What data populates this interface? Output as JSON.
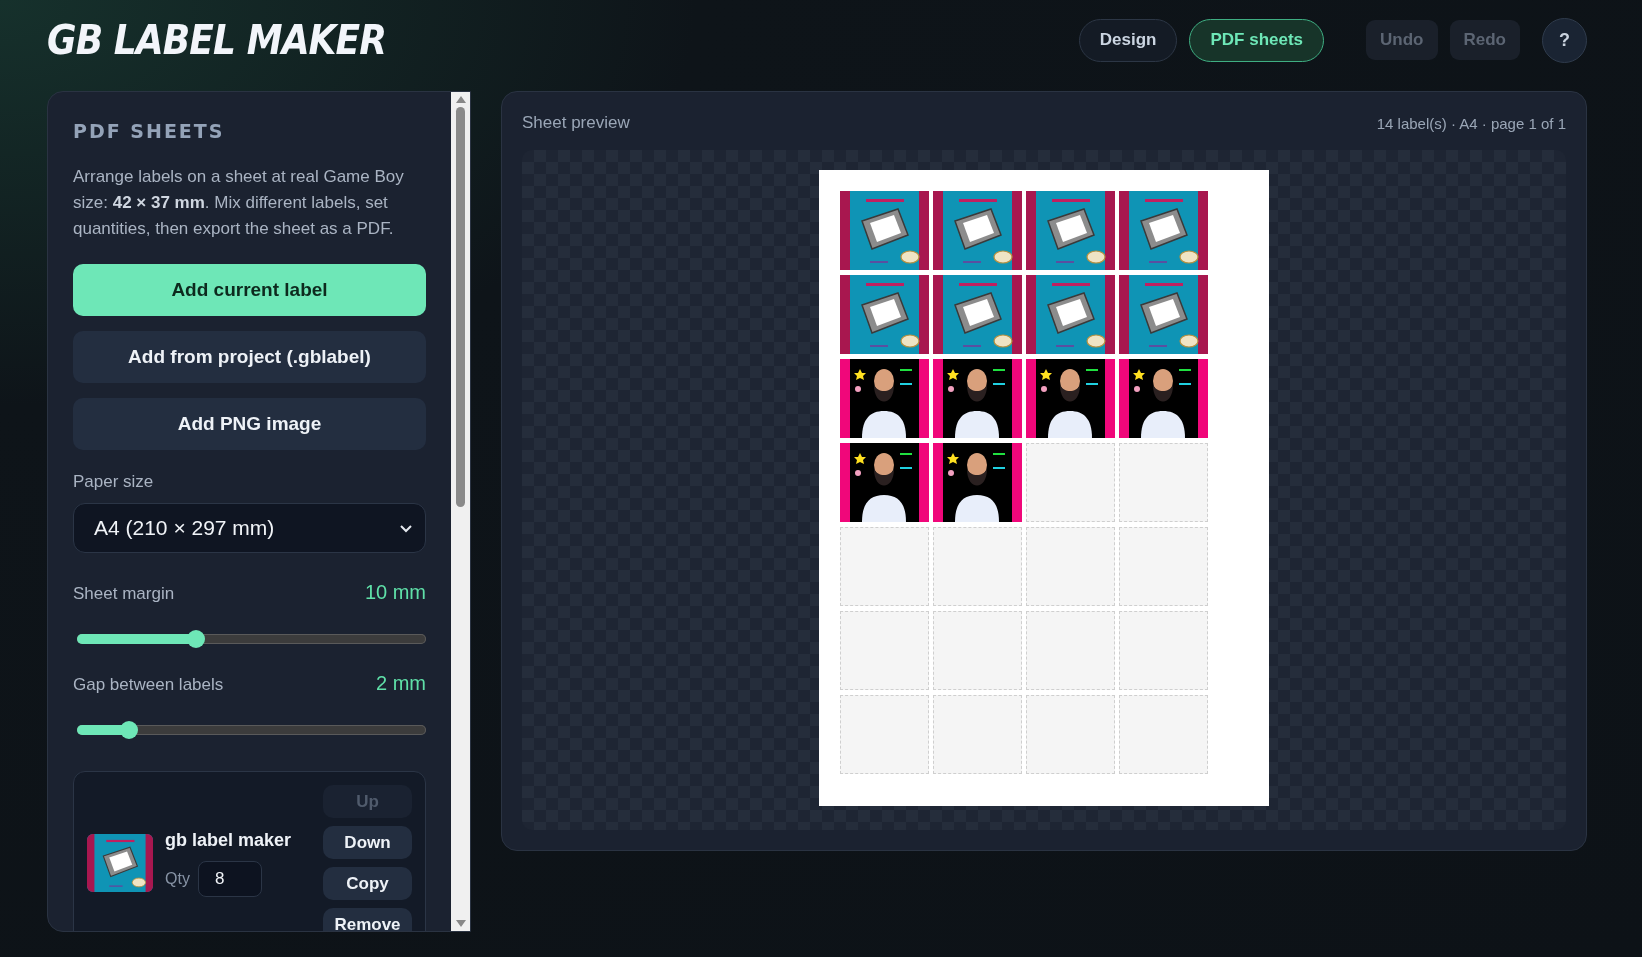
{
  "app_title": "GB LABEL MAKER",
  "nav": [
    {
      "label": "Design",
      "selected": false
    },
    {
      "label": "PDF sheets",
      "selected": true
    }
  ],
  "history": [
    {
      "label": "Undo",
      "disabled": true
    },
    {
      "label": "Redo",
      "disabled": true
    }
  ],
  "help": "?",
  "panel": {
    "heading": "PDF SHEETS",
    "description": "Arrange labels on a sheet at real Game Boy size: **42 × 37 mm**. Mix different labels, set quantities, then export the sheet as a PDF.",
    "actions": [
      {
        "label": "Add current label",
        "kind": "primary"
      },
      {
        "label": "Add from project (.gblabel)",
        "kind": "secondary"
      },
      {
        "label": "Add PNG image",
        "kind": "secondary"
      }
    ],
    "paper": {
      "label": "Paper size",
      "value": "A4 (210 × 297 mm)"
    },
    "sliders": [
      {
        "label": "Sheet margin",
        "reading": "10 mm",
        "level": 0.34
      },
      {
        "label": "Gap between labels",
        "reading": "2 mm",
        "level": 0.15
      }
    ],
    "items": [
      {
        "name": "gb label maker",
        "qty_label": "Qty",
        "qty": "8",
        "buttons": [
          {
            "label": "Up",
            "disabled": true
          },
          {
            "label": "Down",
            "disabled": false
          },
          {
            "label": "Copy",
            "disabled": false
          },
          {
            "label": "Remove",
            "disabled": false
          }
        ]
      }
    ]
  },
  "preview": {
    "title": "Sheet preview",
    "status": "14 label(s) · A4 · page 1 of 1",
    "slots": [
      {
        "kind": "cart"
      },
      {
        "kind": "cart"
      },
      {
        "kind": "cart"
      },
      {
        "kind": "cart"
      },
      {
        "kind": "cart"
      },
      {
        "kind": "cart"
      },
      {
        "kind": "cart"
      },
      {
        "kind": "cart"
      },
      {
        "kind": "figure"
      },
      {
        "kind": "figure"
      },
      {
        "kind": "figure"
      },
      {
        "kind": "figure"
      },
      {
        "kind": "figure"
      },
      {
        "kind": "figure"
      },
      {
        "kind": "empty"
      },
      {
        "kind": "empty"
      },
      {
        "kind": "empty"
      },
      {
        "kind": "empty"
      },
      {
        "kind": "empty"
      },
      {
        "kind": "empty"
      },
      {
        "kind": "empty"
      },
      {
        "kind": "empty"
      },
      {
        "kind": "empty"
      },
      {
        "kind": "empty"
      },
      {
        "kind": "empty"
      },
      {
        "kind": "empty"
      },
      {
        "kind": "empty"
      },
      {
        "kind": "empty"
      }
    ]
  }
}
